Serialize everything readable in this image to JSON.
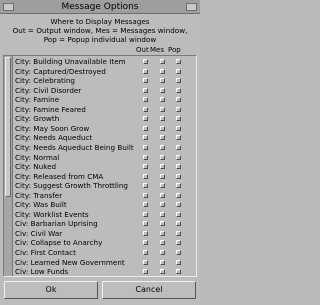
{
  "window": {
    "title": "Message Options"
  },
  "description": {
    "line1": "Where to Display Messages",
    "line2": "Out = Output window, Mes = Messages window,",
    "line3": "Pop = Popup individual window"
  },
  "columns": {
    "out": "Out",
    "mes": "Mes",
    "pop": "Pop"
  },
  "messages": [
    {
      "label": "City: Building Unavailable Item"
    },
    {
      "label": "City: Captured/Destroyed"
    },
    {
      "label": "City: Celebrating"
    },
    {
      "label": "City: Civil Disorder"
    },
    {
      "label": "City: Famine"
    },
    {
      "label": "City: Famine Feared"
    },
    {
      "label": "City: Growth"
    },
    {
      "label": "City: May Soon Grow"
    },
    {
      "label": "City: Needs Aqueduct"
    },
    {
      "label": "City: Needs Aqueduct Being Built"
    },
    {
      "label": "City: Normal"
    },
    {
      "label": "City: Nuked"
    },
    {
      "label": "City: Released from CMA"
    },
    {
      "label": "City: Suggest Growth Throttling"
    },
    {
      "label": "City: Transfer"
    },
    {
      "label": "City: Was Built"
    },
    {
      "label": "City: Worklist Events"
    },
    {
      "label": "Civ: Barbarian Uprising"
    },
    {
      "label": "Civ: Civil War"
    },
    {
      "label": "Civ: Collapse to Anarchy"
    },
    {
      "label": "Civ: First Contact"
    },
    {
      "label": "Civ: Learned New Government"
    },
    {
      "label": "Civ: Low Funds"
    }
  ],
  "buttons": {
    "ok": "Ok",
    "cancel": "Cancel"
  }
}
